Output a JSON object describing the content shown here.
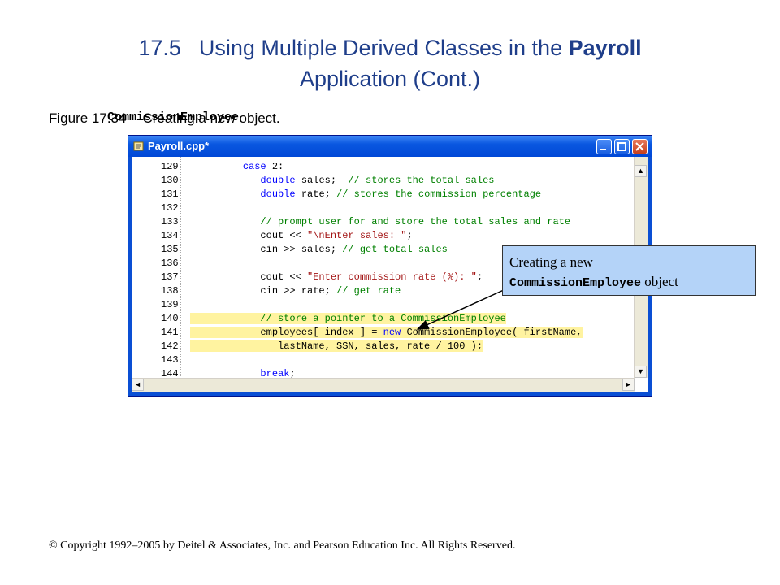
{
  "slide": {
    "number": "17.5",
    "title_pre": "Using Multiple Derived Classes in the ",
    "title_bold": "Payroll",
    "title_post": "Application (Cont.)",
    "figure_label": "Figure 17.34",
    "caption_pre": "Creating a new ",
    "caption_code": "CommissionEmployee",
    "caption_post": " object.",
    "copyright": "© Copyright 1992–2005 by Deitel & Associates, Inc. and Pearson Education Inc. All Rights Reserved."
  },
  "window": {
    "title": "Payroll.cpp*",
    "minimize_icon": "minimize-icon",
    "maximize_icon": "maximize-icon",
    "close_icon": "close-icon"
  },
  "code_lines": [
    {
      "num": "129",
      "parts": [
        [
          "",
          "         "
        ],
        [
          "kw",
          "case"
        ],
        [
          "",
          " 2:"
        ]
      ]
    },
    {
      "num": "130",
      "parts": [
        [
          "",
          "            "
        ],
        [
          "kw",
          "double"
        ],
        [
          "",
          " sales;  "
        ],
        [
          "cm",
          "// stores the total sales"
        ]
      ]
    },
    {
      "num": "131",
      "parts": [
        [
          "",
          "            "
        ],
        [
          "kw",
          "double"
        ],
        [
          "",
          " rate; "
        ],
        [
          "cm",
          "// stores the commission percentage"
        ]
      ]
    },
    {
      "num": "132",
      "parts": [
        [
          "",
          ""
        ]
      ]
    },
    {
      "num": "133",
      "parts": [
        [
          "",
          "            "
        ],
        [
          "cm",
          "// prompt user for and store the total sales and rate"
        ]
      ]
    },
    {
      "num": "134",
      "parts": [
        [
          "",
          "            cout << "
        ],
        [
          "st",
          "\"\\nEnter sales: \""
        ],
        [
          "",
          ";"
        ]
      ]
    },
    {
      "num": "135",
      "parts": [
        [
          "",
          "            cin >> sales; "
        ],
        [
          "cm",
          "// get total sales"
        ]
      ]
    },
    {
      "num": "136",
      "parts": [
        [
          "",
          ""
        ]
      ]
    },
    {
      "num": "137",
      "parts": [
        [
          "",
          "            cout << "
        ],
        [
          "st",
          "\"Enter commission rate (%): \""
        ],
        [
          "",
          ";"
        ]
      ]
    },
    {
      "num": "138",
      "parts": [
        [
          "",
          "            cin >> rate; "
        ],
        [
          "cm",
          "// get rate"
        ]
      ]
    },
    {
      "num": "139",
      "parts": [
        [
          "",
          ""
        ]
      ]
    },
    {
      "num": "140",
      "hl": true,
      "parts": [
        [
          "",
          "            "
        ],
        [
          "cm",
          "// store a pointer to a CommissionEmployee"
        ]
      ]
    },
    {
      "num": "141",
      "hl": true,
      "parts": [
        [
          "",
          "            employees[ index ] = "
        ],
        [
          "kw",
          "new"
        ],
        [
          "",
          " CommissionEmployee( firstName,"
        ]
      ]
    },
    {
      "num": "142",
      "hl": true,
      "parts": [
        [
          "",
          "               lastName, SSN, sales, rate / 100 );"
        ]
      ]
    },
    {
      "num": "143",
      "parts": [
        [
          "",
          ""
        ]
      ]
    },
    {
      "num": "144",
      "parts": [
        [
          "",
          "            "
        ],
        [
          "kw",
          "break"
        ],
        [
          "",
          ";"
        ]
      ]
    }
  ],
  "callout": {
    "line1": "Creating a new",
    "code": "CommissionEmployee",
    "line2": " object"
  },
  "colors": {
    "title": "#1f3e8a",
    "highlight": "#fff3a0",
    "callout_bg": "#b4d3f8",
    "comment": "#008000",
    "keyword": "#0000ff",
    "string": "#a31515"
  }
}
